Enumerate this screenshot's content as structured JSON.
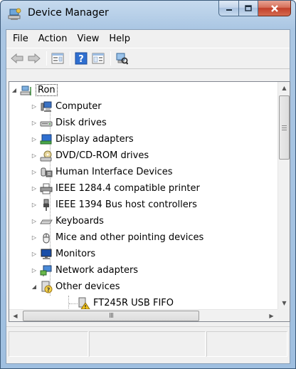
{
  "window": {
    "title": "Device Manager",
    "icon": "device-manager-icon",
    "caption_buttons": [
      "minimize",
      "maximize",
      "close"
    ]
  },
  "menu": {
    "items": [
      "File",
      "Action",
      "View",
      "Help"
    ]
  },
  "toolbar": {
    "buttons": [
      "back-arrow-icon",
      "forward-arrow-icon",
      "properties-icon",
      "help-icon",
      "view-icon",
      "scan-hardware-icon"
    ]
  },
  "tree": {
    "root": {
      "label": "Ron",
      "icon": "computer-network-icon"
    },
    "items": [
      {
        "label": "Computer",
        "icon": "computer-icon",
        "expanded": false
      },
      {
        "label": "Disk drives",
        "icon": "disk-drive-icon",
        "expanded": false
      },
      {
        "label": "Display adapters",
        "icon": "display-adapter-icon",
        "expanded": false
      },
      {
        "label": "DVD/CD-ROM drives",
        "icon": "dvd-drive-icon",
        "expanded": false
      },
      {
        "label": "Human Interface Devices",
        "icon": "hid-icon",
        "expanded": false
      },
      {
        "label": "IEEE 1284.4 compatible printer",
        "icon": "printer-icon",
        "expanded": false
      },
      {
        "label": "IEEE 1394 Bus host controllers",
        "icon": "firewire-icon",
        "expanded": false
      },
      {
        "label": "Keyboards",
        "icon": "keyboard-icon",
        "expanded": false
      },
      {
        "label": "Mice and other pointing devices",
        "icon": "mouse-icon",
        "expanded": false
      },
      {
        "label": "Monitors",
        "icon": "monitor-icon",
        "expanded": false
      },
      {
        "label": "Network adapters",
        "icon": "network-adapter-icon",
        "expanded": false
      },
      {
        "label": "Other devices",
        "icon": "unknown-device-icon",
        "expanded": true
      }
    ],
    "child": {
      "label": "FT245R USB FIFO",
      "icon": "warning-device-icon"
    }
  },
  "scrollbars": {
    "horizontal_thumb_glyph": "III"
  }
}
